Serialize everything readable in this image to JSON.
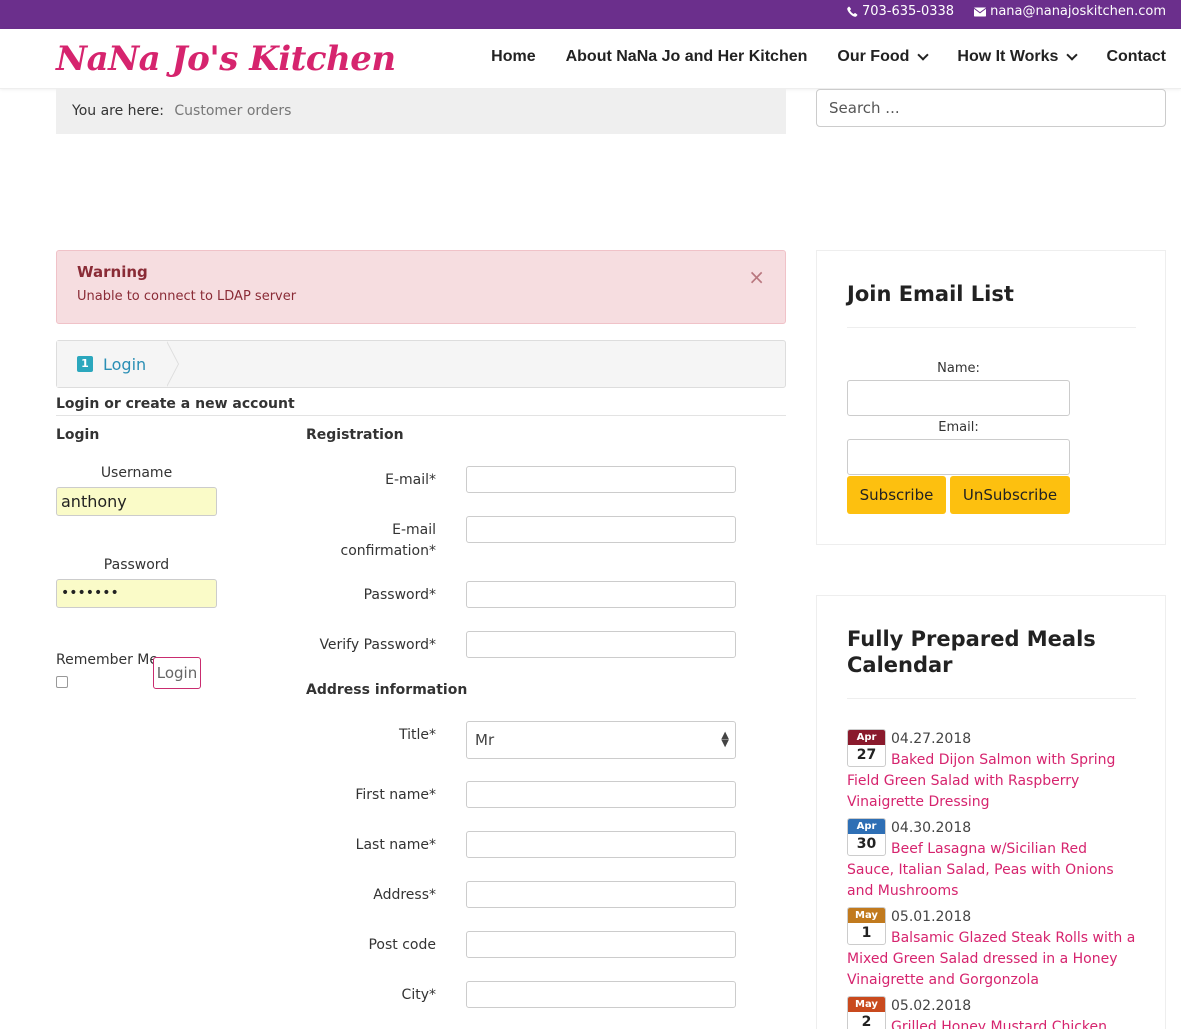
{
  "topbar": {
    "phone": "703-635-0338",
    "email": "nana@nanajoskitchen.com"
  },
  "header": {
    "logo": "NaNa Jo's Kitchen",
    "nav": [
      {
        "label": "Home"
      },
      {
        "label": "About NaNa Jo and Her Kitchen"
      },
      {
        "label": "Our Food"
      },
      {
        "label": "How It Works"
      },
      {
        "label": "Contact"
      }
    ]
  },
  "breadcrumb": {
    "prefix": "You are here:",
    "current": "Customer orders"
  },
  "search": {
    "placeholder": "Search ..."
  },
  "alert": {
    "title": "Warning",
    "message": "Unable to connect to LDAP server",
    "close": "×"
  },
  "steps": [
    {
      "number": "1",
      "label": "Login"
    }
  ],
  "login": {
    "section_title": "Login or create a new account",
    "heading": "Login",
    "username_label": "Username",
    "username_value": "anthony",
    "password_label": "Password",
    "password_value": "•••••••",
    "remember_label": "Remember Me",
    "login_button": "Login"
  },
  "registration": {
    "heading": "Registration",
    "email_label": "E-mail*",
    "email_confirm_label": "E-mail confirmation*",
    "password_label": "Password*",
    "verify_password_label": "Verify Password*",
    "address_heading": "Address information",
    "title_label": "Title*",
    "title_value": "Mr",
    "first_name_label": "First name*",
    "last_name_label": "Last name*",
    "address_label": "Address*",
    "post_code_label": "Post code",
    "city_label": "City*"
  },
  "email_widget": {
    "title": "Join Email List",
    "name_label": "Name:",
    "email_label": "Email:",
    "subscribe": "Subscribe",
    "unsubscribe": "UnSubscribe",
    "button_color": "#fdc00f"
  },
  "calendar_widget": {
    "title": "Fully Prepared Meals Calendar",
    "events": [
      {
        "month": "Apr",
        "day": "27",
        "date": "04.27.2018",
        "title": "Baked Dijon Salmon with Spring Field Green Salad with Raspberry Vinaigrette Dressing",
        "color": "#8a1a2c"
      },
      {
        "month": "Apr",
        "day": "30",
        "date": "04.30.2018",
        "title": "Beef Lasagna w/Sicilian Red Sauce, Italian Salad, Peas with Onions and Mushrooms",
        "color": "#2e6fb5"
      },
      {
        "month": "May",
        "day": "1",
        "date": "05.01.2018",
        "title": "Balsamic Glazed Steak Rolls with a Mixed Green Salad dressed in a Honey Vinaigrette and Gorgonzola",
        "color": "#c17a1e"
      },
      {
        "month": "May",
        "day": "2",
        "date": "05.02.2018",
        "title": "Grilled Honey Mustard Chicken with",
        "color": "#c94a1e"
      }
    ]
  },
  "colors": {
    "topbar": "#6b2f8c",
    "brand": "#d6246e",
    "link": "#d6246e"
  }
}
